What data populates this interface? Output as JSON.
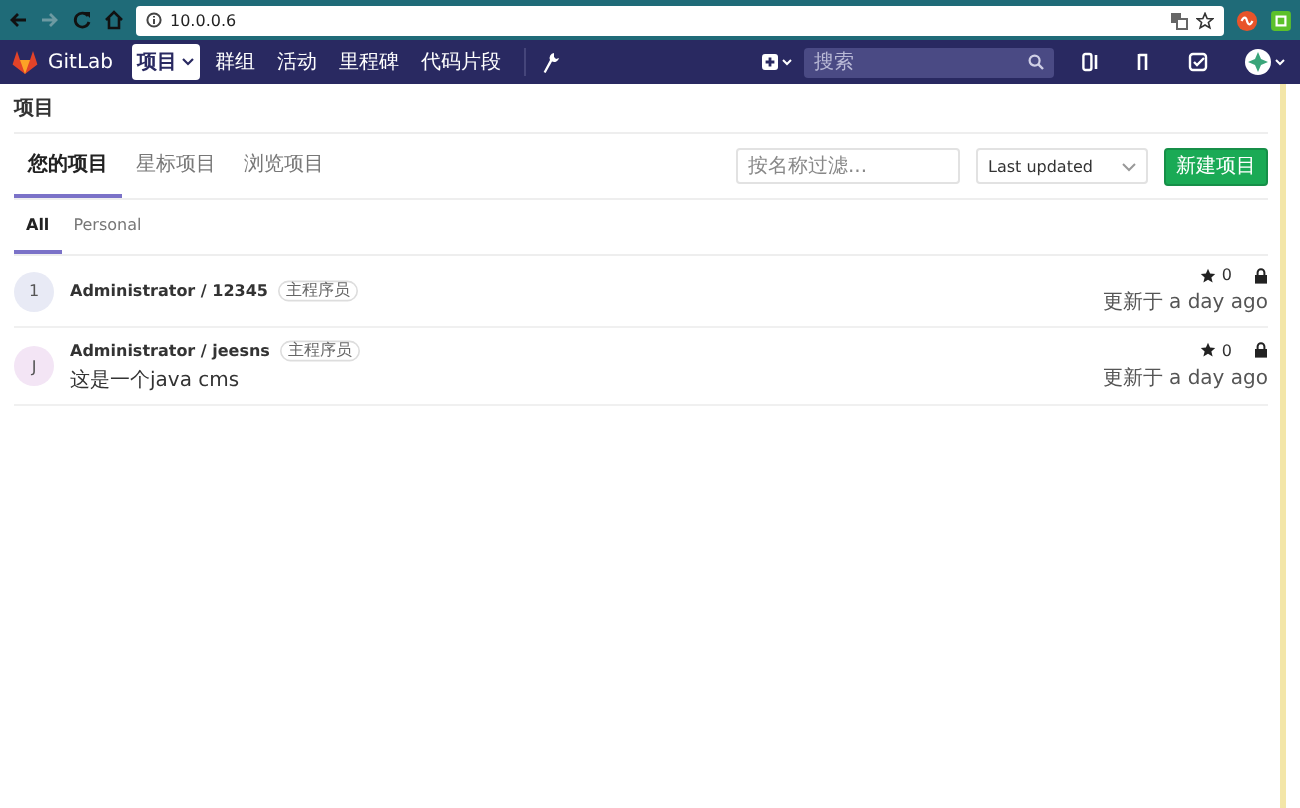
{
  "browser": {
    "url": "10.0.0.6"
  },
  "navbar": {
    "brand": "GitLab",
    "menu": [
      {
        "label": "项目",
        "selected": true,
        "dropdown": true
      },
      {
        "label": "群组",
        "selected": false,
        "dropdown": false
      },
      {
        "label": "活动",
        "selected": false,
        "dropdown": false
      },
      {
        "label": "里程碑",
        "selected": false,
        "dropdown": false
      },
      {
        "label": "代码片段",
        "selected": false,
        "dropdown": false
      }
    ],
    "search": {
      "placeholder": "搜索"
    }
  },
  "breadcrumb": "项目",
  "tabs": [
    {
      "label": "您的项目",
      "selected": true
    },
    {
      "label": "星标项目",
      "selected": false
    },
    {
      "label": "浏览项目",
      "selected": false
    }
  ],
  "filter": {
    "placeholder": "按名称过滤..."
  },
  "sort": {
    "value": "Last updated"
  },
  "new_button": "新建项目",
  "subtabs": [
    {
      "label": "All",
      "selected": true
    },
    {
      "label": "Personal",
      "selected": false
    }
  ],
  "projects": [
    {
      "avatar": "1",
      "color": "#e8eaf5",
      "name": "Administrator / 12345",
      "role": "主程序员",
      "star_count": "0",
      "updated": "更新于 a day ago"
    },
    {
      "avatar": "J",
      "color": "#f3e5f5",
      "name": "Administrator / jeesns",
      "role": "主程序员",
      "description": "这是一个java cms",
      "star_count": "0",
      "updated": "更新于 a day ago"
    }
  ]
}
